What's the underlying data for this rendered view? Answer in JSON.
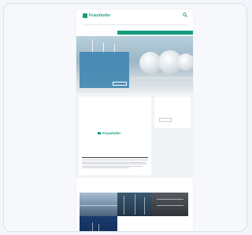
{
  "header": {
    "logo_text": "Fraunhofer",
    "logo_subtitle": "",
    "breadcrumb": "",
    "nav_items": [
      "",
      "",
      "",
      "",
      ""
    ]
  },
  "hero": {
    "title": "",
    "text": "",
    "button_label": ""
  },
  "main_card": {
    "title": "",
    "logo_text": "Fraunhofer",
    "logo_subtext": ""
  },
  "side_card": {
    "title": "",
    "button_label": ""
  },
  "section": {
    "label": "",
    "tiles": [
      {
        "label": ""
      },
      {
        "label": ""
      },
      {
        "label": ""
      },
      {
        "label": ""
      }
    ]
  },
  "colors": {
    "accent_green": "#179c7d",
    "accent_blue": "#2c7fb8",
    "hero_box": "#3c84b0"
  },
  "icons": {
    "search": "search-icon"
  }
}
